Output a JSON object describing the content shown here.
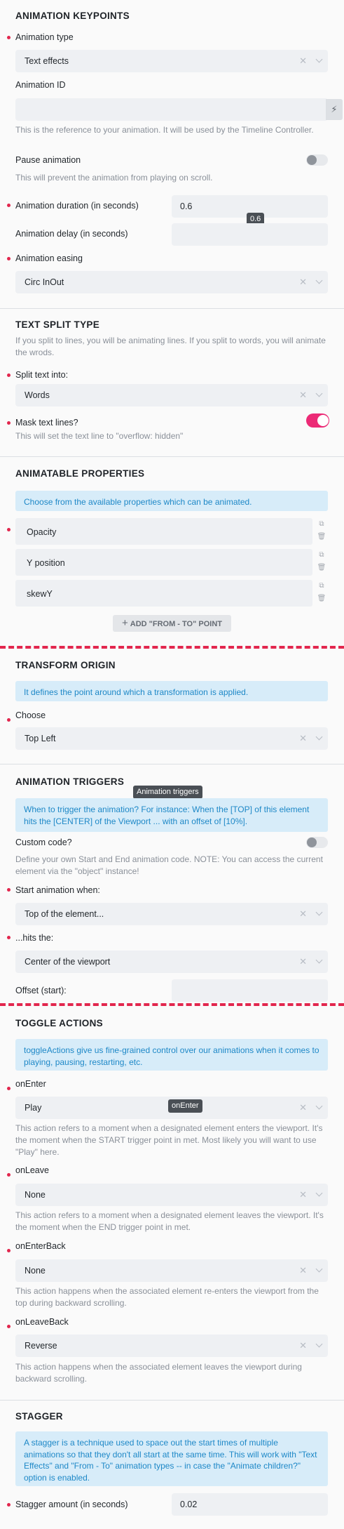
{
  "keypoints": {
    "title": "ANIMATION KEYPOINTS",
    "type_label": "Animation type",
    "type_value": "Text effects",
    "id_label": "Animation ID",
    "id_value": "",
    "id_help": "This is the reference to your animation. It will be used by the Timeline Controller.",
    "pause_label": "Pause animation",
    "pause_on": false,
    "pause_help": "This will prevent the animation from playing on scroll.",
    "duration_label": "Animation duration (in seconds)",
    "duration_value": "0.6",
    "duration_tooltip": "0.6",
    "delay_label": "Animation delay (in seconds)",
    "delay_value": "",
    "easing_label": "Animation easing",
    "easing_value": "Circ InOut"
  },
  "split": {
    "title": "TEXT SPLIT TYPE",
    "help": "If you split to lines, you will be animating lines. If you split to words, you will animate the wrods.",
    "into_label": "Split text into:",
    "into_value": "Words",
    "mask_label": "Mask text lines?",
    "mask_on": true,
    "mask_help": "This will set the text line to \"overflow: hidden\""
  },
  "props": {
    "title": "ANIMATABLE PROPERTIES",
    "info": "Choose from the available properties which can be animated.",
    "items": [
      "Opacity",
      "Y position",
      "skewY"
    ],
    "add_label": "ADD \"FROM - TO\" POINT"
  },
  "origin": {
    "title": "TRANSFORM ORIGIN",
    "info": "It defines the point around which a transformation is applied.",
    "choose_label": "Choose",
    "choose_value": "Top Left"
  },
  "triggers": {
    "title": "ANIMATION TRIGGERS",
    "tooltip": "Animation triggers",
    "info": "When to trigger the animation? For instance: When the [TOP] of this element hits the [CENTER] of the Viewport ... with an offset of [10%].",
    "custom_label": "Custom code?",
    "custom_on": false,
    "custom_help": "Define your own Start and End animation code. NOTE: You can access the current element via the \"object\" instance!",
    "start_label": "Start animation when:",
    "start_value": "Top of the element...",
    "hits_label": "...hits the:",
    "hits_value": "Center of the viewport",
    "offset_label": "Offset (start):",
    "offset_value": ""
  },
  "toggle": {
    "title": "TOGGLE ACTIONS",
    "info": "toggleActions give us fine-grained control over our animations when it comes to playing, pausing, restarting, etc.",
    "tooltip": "onEnter",
    "onenter_label": "onEnter",
    "onenter_value": "Play",
    "onenter_help": "This action refers to a moment when a designated element enters the viewport. It's the moment when the START trigger point in met. Most likely you will want to use \"Play\" here.",
    "onleave_label": "onLeave",
    "onleave_value": "None",
    "onleave_help": "This action refers to a moment when a designated element leaves the viewport. It's the moment when the END trigger point in met.",
    "onenterback_label": "onEnterBack",
    "onenterback_value": "None",
    "onenterback_help": "This action happens when the associated element re-enters the viewport from the top during backward scrolling.",
    "onleaveback_label": "onLeaveBack",
    "onleaveback_value": "Reverse",
    "onleaveback_help": "This action happens when the associated element leaves the viewport during backward scrolling."
  },
  "stagger": {
    "title": "STAGGER",
    "info": "A stagger is a technique used to space out the start times of multiple animations so that they don't all start at the same time. This will work with \"Text Effects\" and \"From - To\" animation types -- in case the \"Animate children?\" option is enabled.",
    "amount_label": "Stagger amount (in seconds)",
    "amount_value": "0.02"
  },
  "icons": {
    "clear": "close-icon",
    "dropdown": "chevron-down-icon",
    "bolt": "bolt-icon",
    "copy": "copy-icon",
    "delete": "trash-icon",
    "plus": "plus-icon"
  },
  "colors": {
    "required_dot": "#e2264d",
    "toggle_on": "#ec2a76",
    "info_bg": "#d7ecf9",
    "info_text": "#1e88c7"
  }
}
